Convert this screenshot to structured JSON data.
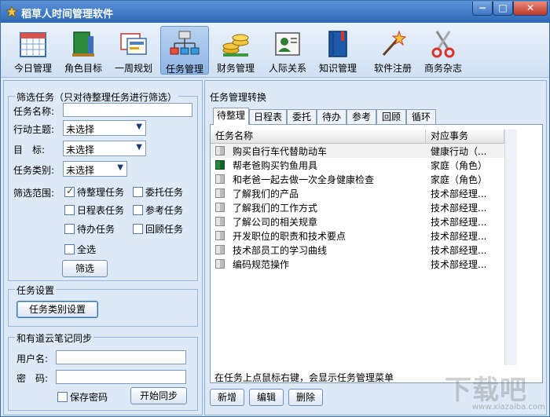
{
  "window": {
    "title": "稻草人时间管理软件",
    "minimize": "−",
    "maximize": "□",
    "close": "✕"
  },
  "toolbar": {
    "items": [
      {
        "label": "今日管理",
        "icon": "calendar-icon"
      },
      {
        "label": "角色目标",
        "icon": "books-icon"
      },
      {
        "label": "一周规划",
        "icon": "weekly-cards-icon"
      },
      {
        "label": "任务管理",
        "icon": "org-chart-icon",
        "active": true
      },
      {
        "label": "财务管理",
        "icon": "coins-icon"
      },
      {
        "label": "人际关系",
        "icon": "contact-card-icon"
      },
      {
        "label": "知识管理",
        "icon": "book-icon"
      },
      {
        "label": "软件注册",
        "icon": "magic-wand-icon"
      },
      {
        "label": "商务杂志",
        "icon": "scissors-icon"
      }
    ]
  },
  "filter": {
    "title": "筛选任务（只对待整理任务进行筛选）",
    "name_label": "任务名称:",
    "name_value": "",
    "theme_label": "行动主题:",
    "theme_value": "未选择",
    "goal_label": "目　标:",
    "goal_value": "未选择",
    "category_label": "任务类别:",
    "category_value": "未选择",
    "scope_label": "筛选范围:",
    "checkboxes": [
      {
        "label": "待整理任务",
        "checked": true
      },
      {
        "label": "委托任务",
        "checked": false
      },
      {
        "label": "日程表任务",
        "checked": false
      },
      {
        "label": "参考任务",
        "checked": false
      },
      {
        "label": "待办任务",
        "checked": false
      },
      {
        "label": "回顾任务",
        "checked": false
      },
      {
        "label": "全选",
        "checked": false
      }
    ],
    "filter_button": "筛选"
  },
  "settings": {
    "title": "任务设置",
    "button": "任务类别设置"
  },
  "sync": {
    "title": "和有道云笔记同步",
    "user_label": "用户名:",
    "user_value": "",
    "pass_label": "密　码:",
    "pass_value": "",
    "save_label": "保存密码",
    "sync_button": "开始同步"
  },
  "task_panel": {
    "title": "任务管理转换",
    "tabs": [
      "待整理",
      "日程表",
      "委托",
      "待办",
      "参考",
      "回顾",
      "循环"
    ],
    "active_tab": 0,
    "columns": [
      "任务名称",
      "对应事务"
    ],
    "rows": [
      {
        "name": "购买自行车代替助动车",
        "category": "健康行动（...",
        "icon": "task-gray-icon",
        "selected": true
      },
      {
        "name": "帮老爸购买钓鱼用具",
        "category": "家庭（角色）",
        "icon": "task-green-icon"
      },
      {
        "name": "和老爸一起去做一次全身健康检查",
        "category": "家庭（角色）",
        "icon": "task-gray-icon"
      },
      {
        "name": "了解我们的产品",
        "category": "技术部经理...",
        "icon": "task-gray-icon"
      },
      {
        "name": "了解我们的工作方式",
        "category": "技术部经理...",
        "icon": "task-gray-icon"
      },
      {
        "name": "了解公司的相关规章",
        "category": "技术部经理...",
        "icon": "task-gray-icon"
      },
      {
        "name": "开发职位的职责和技术要点",
        "category": "技术部经理...",
        "icon": "task-gray-icon"
      },
      {
        "name": "技术部员工的学习曲线",
        "category": "技术部经理...",
        "icon": "task-gray-icon"
      },
      {
        "name": "编码规范操作",
        "category": "技术部经理...",
        "icon": "task-gray-icon"
      }
    ],
    "hint": "在任务上点鼠标右键，会显示任务管理菜单",
    "buttons": {
      "add": "新增",
      "edit": "编辑",
      "delete": "删除"
    }
  },
  "watermark": {
    "text": "下载吧",
    "url": "www.xiazaiba.com"
  }
}
